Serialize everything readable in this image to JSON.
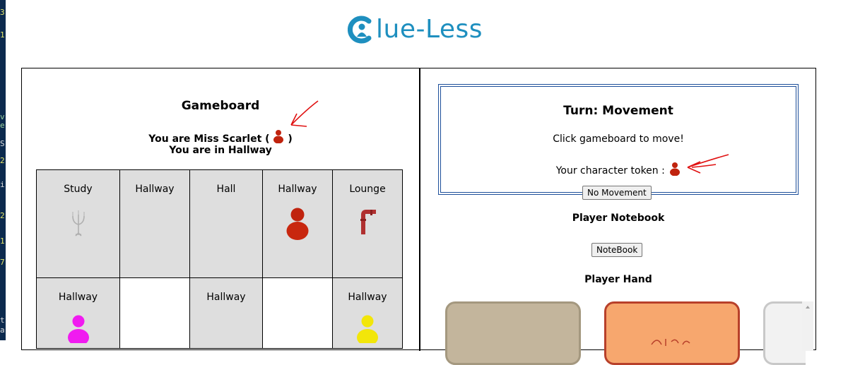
{
  "logo": {
    "text": "lue-Less"
  },
  "gameboard": {
    "title": "Gameboard",
    "you_are_prefix": "You are Miss Scarlet (",
    "you_are_suffix": ")",
    "location": "You are in Hallway",
    "rows": [
      [
        {
          "label": "Study",
          "type": "room",
          "icon": "candlestick-icon"
        },
        {
          "label": "Hallway",
          "type": "room",
          "icon": ""
        },
        {
          "label": "Hall",
          "type": "room",
          "icon": ""
        },
        {
          "label": "Hallway",
          "type": "room",
          "icon": "miss-scarlet-token-icon"
        },
        {
          "label": "Lounge",
          "type": "room",
          "icon": "lead-pipe-icon"
        }
      ],
      [
        {
          "label": "Hallway",
          "type": "room",
          "icon": "magenta-token-icon"
        },
        {
          "label": "",
          "type": "empty",
          "icon": ""
        },
        {
          "label": "Hallway",
          "type": "room",
          "icon": ""
        },
        {
          "label": "",
          "type": "empty",
          "icon": ""
        },
        {
          "label": "Hallway",
          "type": "room",
          "icon": "yellow-token-icon"
        }
      ]
    ]
  },
  "turn": {
    "title": "Turn: Movement",
    "message": "Click gameboard to move!",
    "token_label": "Your character token :",
    "no_movement_button": "No Movement"
  },
  "notebook": {
    "title": "Player Notebook",
    "button": "NoteBook"
  },
  "hand": {
    "title": "Player Hand"
  },
  "colors": {
    "scarlet": "#c0230e",
    "magenta": "#f01bf0",
    "yellow": "#f2e60a",
    "room_bg": "#dedede",
    "accent_blue": "#1d4f9a",
    "logo_blue": "#1e8fbf",
    "annotation_red": "#e01010"
  }
}
